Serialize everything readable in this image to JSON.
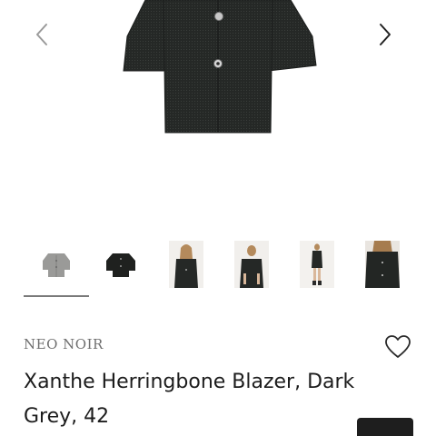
{
  "gallery": {
    "prev_icon": "chevron-left-icon",
    "next_icon": "chevron-right-icon",
    "main_image": "black herringbone short-sleeve blazer",
    "thumbnails": [
      {
        "name": "grey-blazer-flat",
        "selected": true
      },
      {
        "name": "black-blazer-flat",
        "selected": false
      },
      {
        "name": "model-front-blazer",
        "selected": false
      },
      {
        "name": "model-back-blazer",
        "selected": false
      },
      {
        "name": "model-full-outfit",
        "selected": false
      },
      {
        "name": "model-closeup-blazer",
        "selected": false
      }
    ]
  },
  "product": {
    "brand": "NEO NOIR",
    "title": "Xanthe Herringbone Blazer, Dark Grey, 42",
    "wishlist_icon": "heart-icon"
  },
  "colors": {
    "indicator": "#7a7a7a",
    "cta": "#1e1e1e",
    "brand_text": "#6f6f6f"
  }
}
